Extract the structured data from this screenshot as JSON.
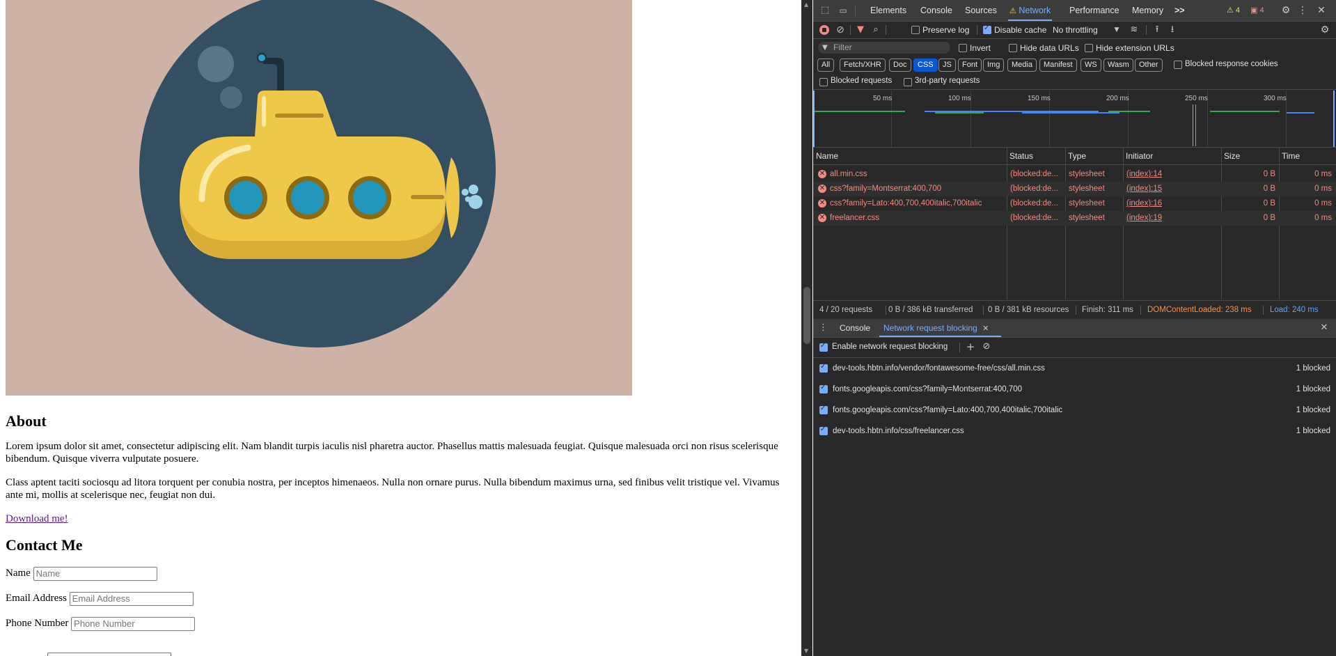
{
  "page": {
    "about_heading": "About",
    "about_p1": "Lorem ipsum dolor sit amet, consectetur adipiscing elit. Nam blandit turpis iaculis nisl pharetra auctor. Phasellus mattis malesuada feugiat. Quisque malesuada orci non risus scelerisque bibendum. Quisque viverra vulputate posuere.",
    "about_p2": "Class aptent taciti sociosqu ad litora torquent per conubia nostra, per inceptos himenaeos. Nulla non ornare purus. Nulla bibendum maximus urna, sed finibus velit tristique vel. Vivamus ante mi, mollis at scelerisque nec, feugiat non dui.",
    "download_link": "Download me!",
    "contact_heading": "Contact Me",
    "name_label": "Name",
    "name_placeholder": "Name",
    "email_label": "Email Address",
    "email_placeholder": "Email Address",
    "phone_label": "Phone Number",
    "phone_placeholder": "Phone Number",
    "colors": {
      "hero_bg": "#cdb2a5",
      "circle": "#344f61",
      "sub": "#efc84a",
      "link_visited": "#551a8b"
    }
  },
  "devtools": {
    "tabs": [
      "Elements",
      "Console",
      "Sources",
      "Network",
      "Performance",
      "Memory"
    ],
    "active_tab": "Network",
    "more_tabs": ">>",
    "warnings_count": "4",
    "errors_count": "4",
    "toolbar": {
      "preserve_log": "Preserve log",
      "preserve_log_checked": false,
      "disable_cache": "Disable cache",
      "disable_cache_checked": true,
      "throttling": "No throttling"
    },
    "filter": {
      "placeholder": "Filter",
      "invert": "Invert",
      "hide_data_urls": "Hide data URLs",
      "hide_extension_urls": "Hide extension URLs"
    },
    "type_filters": [
      "All",
      "Fetch/XHR",
      "Doc",
      "CSS",
      "JS",
      "Font",
      "Img",
      "Media",
      "Manifest",
      "WS",
      "Wasm",
      "Other"
    ],
    "selected_type": "CSS",
    "blocked_response_cookies": "Blocked response cookies",
    "blocked_requests": "Blocked requests",
    "third_party_requests": "3rd-party requests",
    "timeline_ticks": [
      "50 ms",
      "100 ms",
      "150 ms",
      "200 ms",
      "250 ms",
      "300 ms"
    ],
    "columns": [
      "Name",
      "Status",
      "Type",
      "Initiator",
      "Size",
      "Time"
    ],
    "requests": [
      {
        "name": "all.min.css",
        "status": "(blocked:de...",
        "type": "stylesheet",
        "initiator": "(index):14",
        "size": "0 B",
        "time": "0 ms"
      },
      {
        "name": "css?family=Montserrat:400,700",
        "status": "(blocked:de...",
        "type": "stylesheet",
        "initiator": "(index):15",
        "size": "0 B",
        "time": "0 ms"
      },
      {
        "name": "css?family=Lato:400,700,400italic,700italic",
        "status": "(blocked:de...",
        "type": "stylesheet",
        "initiator": "(index):16",
        "size": "0 B",
        "time": "0 ms"
      },
      {
        "name": "freelancer.css",
        "status": "(blocked:de...",
        "type": "stylesheet",
        "initiator": "(index):19",
        "size": "0 B",
        "time": "0 ms"
      }
    ],
    "status_bar": {
      "requests": "4 / 20 requests",
      "transferred": "0 B / 386 kB transferred",
      "resources": "0 B / 381 kB resources",
      "finish": "Finish: 311 ms",
      "dom_content_loaded": "DOMContentLoaded: 238 ms",
      "load": "Load: 240 ms"
    },
    "drawer": {
      "tabs": [
        "Console",
        "Network request blocking"
      ],
      "active_tab": "Network request blocking",
      "enable_label": "Enable network request blocking",
      "enable_checked": true,
      "patterns": [
        {
          "url": "dev-tools.hbtn.info/vendor/fontawesome-free/css/all.min.css",
          "count": "1 blocked"
        },
        {
          "url": "fonts.googleapis.com/css?family=Montserrat:400,700",
          "count": "1 blocked"
        },
        {
          "url": "fonts.googleapis.com/css?family=Lato:400,700,400italic,700italic",
          "count": "1 blocked"
        },
        {
          "url": "dev-tools.hbtn.info/css/freelancer.css",
          "count": "1 blocked"
        }
      ]
    },
    "colors": {
      "accent": "#7cacf8",
      "error": "#f28b82",
      "dcl": "#ff8f4a",
      "load": "#60a5fa",
      "bg": "#282828"
    }
  }
}
